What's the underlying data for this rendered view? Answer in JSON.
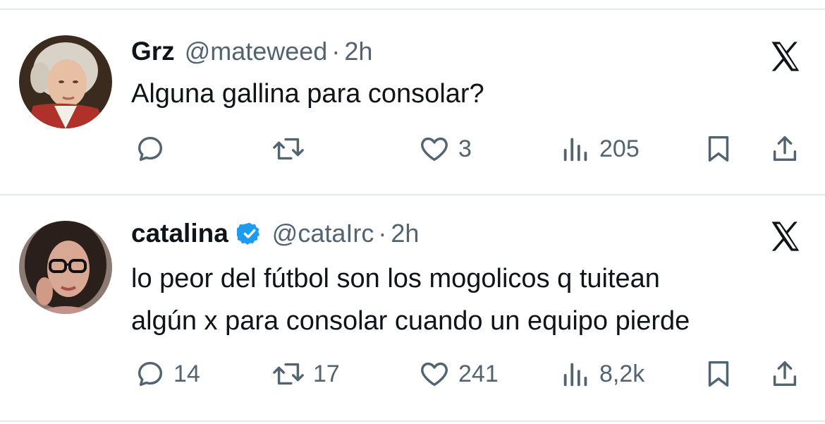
{
  "tweets": [
    {
      "name": "Grz",
      "handle": "@mateweed",
      "separator": "·",
      "time": "2h",
      "verified": false,
      "text_lines": [
        "Alguna gallina para consolar?"
      ],
      "replies": "",
      "retweets": "",
      "likes": "3",
      "views": "205"
    },
    {
      "name": "catalina",
      "handle": "@cataIrc",
      "separator": "·",
      "time": "2h",
      "verified": true,
      "text_lines": [
        "lo peor del fútbol son los mogolicos q tuitean",
        "algún x para consolar cuando un equipo pierde"
      ],
      "replies": "14",
      "retweets": "17",
      "likes": "241",
      "views": "8,2k"
    }
  ],
  "icons": {
    "reply": "reply-icon",
    "retweet": "retweet-icon",
    "like": "heart-icon",
    "views": "views-icon",
    "bookmark": "bookmark-icon",
    "share": "share-icon",
    "platform": "x-logo-icon",
    "verified": "verified-badge-icon"
  },
  "colors": {
    "text": "#0f1419",
    "secondary": "#536471",
    "verified": "#1d9bf0",
    "divider": "#e6e9ec"
  }
}
